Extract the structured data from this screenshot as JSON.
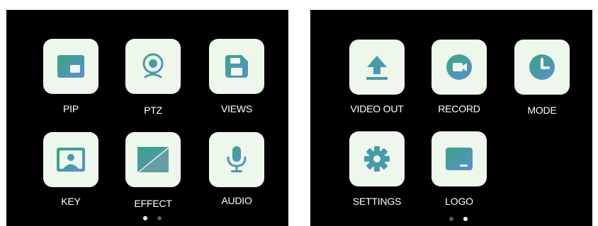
{
  "colors": {
    "background": "#000000",
    "tile": "#eef7ec",
    "gradient_start": "#34a18a",
    "gradient_end": "#5590c8",
    "label": "#ffffff",
    "dot_active": "#ffffff",
    "dot_inactive": "#5a5a5a"
  },
  "pages": [
    {
      "items": [
        {
          "label": "PIP",
          "icon": "pip-icon"
        },
        {
          "label": "PTZ",
          "icon": "webcam-icon"
        },
        {
          "label": "VIEWS",
          "icon": "save-icon"
        },
        {
          "label": "KEY",
          "icon": "portrait-icon"
        },
        {
          "label": "EFFECT",
          "icon": "diagonal-effect-icon"
        },
        {
          "label": "AUDIO",
          "icon": "microphone-icon"
        }
      ],
      "pager": {
        "total": 2,
        "active": 1
      }
    },
    {
      "items": [
        {
          "label": "VIDEO OUT",
          "icon": "upload-icon"
        },
        {
          "label": "RECORD",
          "icon": "record-camera-icon"
        },
        {
          "label": "MODE",
          "icon": "clock-icon"
        },
        {
          "label": "SETTINGS",
          "icon": "gear-icon"
        },
        {
          "label": "LOGO",
          "icon": "logo-screen-icon"
        }
      ],
      "pager": {
        "total": 2,
        "active": 2
      }
    }
  ]
}
